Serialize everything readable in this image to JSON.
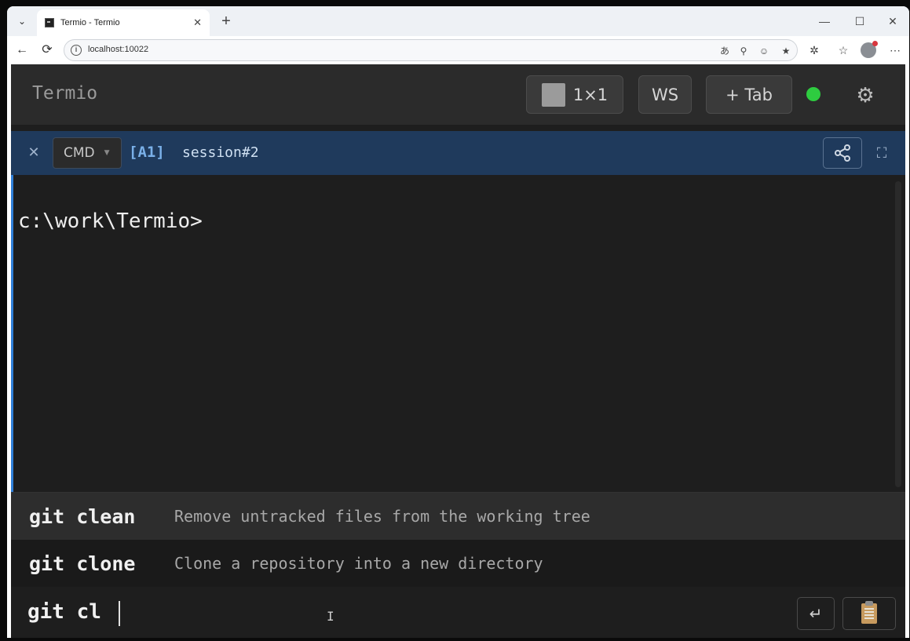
{
  "browser": {
    "tab_title": "Termio - Termio",
    "tab_close": "✕",
    "new_tab": "+",
    "tab_dropdown": "⌄",
    "url": "localhost:10022",
    "window_controls": {
      "minimize": "—",
      "maximize": "☐",
      "close": "✕"
    },
    "nav": {
      "back": "←",
      "reload": "⟳"
    },
    "omni_icons": [
      "translate-icon",
      "zoom-icon",
      "tracking-icon",
      "favorite-star-icon"
    ],
    "toolbar_icons": [
      "extensions-icon",
      "favorites-icon",
      "profile-avatar",
      "more-icon"
    ]
  },
  "app": {
    "brand": "Termio",
    "layout_label": "1×1",
    "ws_label": "WS",
    "add_tab_label": "+ Tab",
    "status_color": "#2ecc40",
    "session": {
      "close": "✕",
      "shell": "CMD",
      "id": "[A1]",
      "name": "session#2"
    },
    "terminal": {
      "lines": [
        "c:\\work\\Termio>"
      ]
    },
    "suggestions": [
      {
        "cmd": "git clean",
        "desc": "Remove untracked files from the working tree"
      },
      {
        "cmd": "git clone",
        "desc": "Clone a repository into a new directory"
      }
    ],
    "input_value": "git cl",
    "enter_glyph": "↵"
  }
}
